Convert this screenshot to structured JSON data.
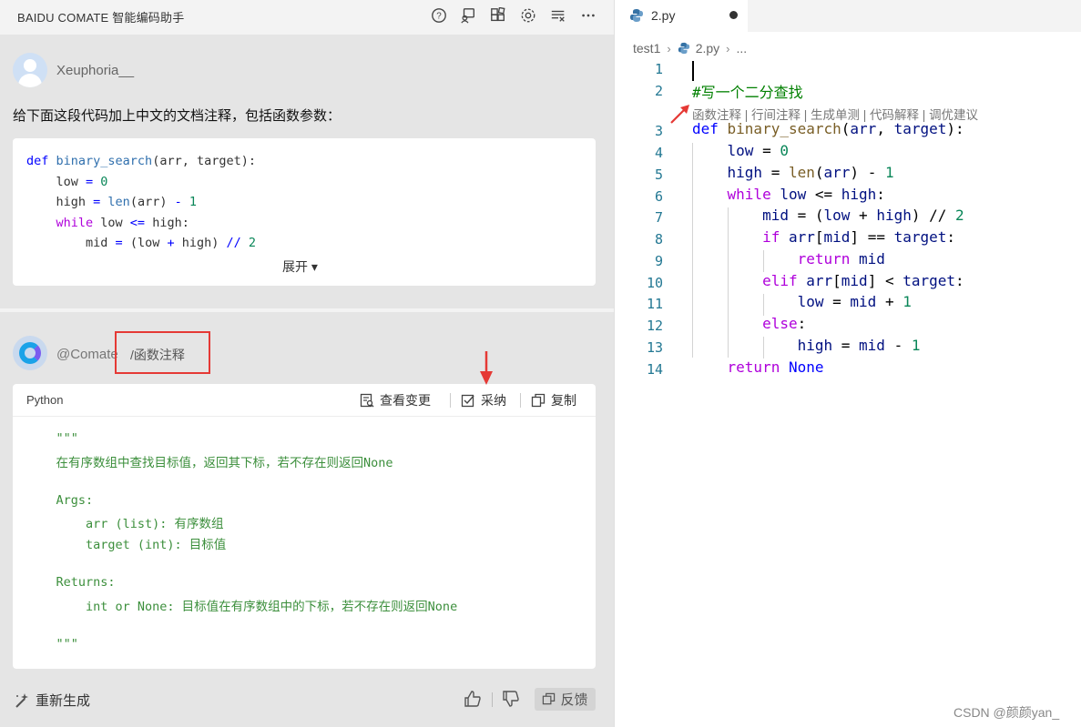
{
  "sidebar": {
    "title": "BAIDU COMATE 智能编码助手",
    "icons": [
      "help-icon",
      "chat-icon",
      "plugin-icon",
      "settings-icon",
      "clear-icon",
      "more-icon"
    ]
  },
  "user_message": {
    "name": "Xeuphoria__",
    "prompt": "给下面这段代码加上中文的文档注释，包括函数参数：",
    "code_lines": [
      {
        "parts": [
          {
            "t": "def ",
            "c": "kw"
          },
          {
            "t": "binary_search",
            "c": "fn"
          },
          {
            "t": "(arr, target):",
            "c": "op"
          }
        ]
      },
      {
        "parts": [
          {
            "t": "    low ",
            "c": "op"
          },
          {
            "t": "= ",
            "c": "kw"
          },
          {
            "t": "0",
            "c": "num"
          }
        ]
      },
      {
        "parts": [
          {
            "t": "    high ",
            "c": "op"
          },
          {
            "t": "= ",
            "c": "kw"
          },
          {
            "t": "len",
            "c": "fn"
          },
          {
            "t": "(arr) ",
            "c": "op"
          },
          {
            "t": "- ",
            "c": "kw"
          },
          {
            "t": "1",
            "c": "num"
          }
        ]
      },
      {
        "parts": [
          {
            "t": "    while ",
            "c": "kw2"
          },
          {
            "t": "low ",
            "c": "op"
          },
          {
            "t": "<= ",
            "c": "kw"
          },
          {
            "t": "high:",
            "c": "op"
          }
        ]
      },
      {
        "parts": [
          {
            "t": "        mid ",
            "c": "op"
          },
          {
            "t": "= ",
            "c": "kw"
          },
          {
            "t": "(low ",
            "c": "op"
          },
          {
            "t": "+ ",
            "c": "kw"
          },
          {
            "t": "high) ",
            "c": "op"
          },
          {
            "t": "// ",
            "c": "kw"
          },
          {
            "t": "2",
            "c": "num"
          }
        ]
      }
    ],
    "expand_label": "展开 ▾"
  },
  "bot_message": {
    "name": "@Comate",
    "command": "/函数注释",
    "result": {
      "language": "Python",
      "actions": {
        "view_changes": "查看变更",
        "accept": "采纳",
        "copy": "复制"
      },
      "doc_lines": [
        "    \"\"\"",
        "    在有序数组中查找目标值，返回其下标，若不存在则返回None",
        "",
        "    Args:",
        "        arr (list): 有序数组",
        "        target (int): 目标值",
        "",
        "    Returns:",
        "        int or None: 目标值在有序数组中的下标，若不存在则返回None",
        "",
        "    \"\"\""
      ]
    },
    "regenerate_label": "重新生成",
    "feedback_label": "反馈"
  },
  "editor": {
    "tab_label": "2.py",
    "breadcrumb": [
      "test1",
      "2.py",
      "..."
    ],
    "codelens": [
      "函数注释",
      "行间注释",
      "生成单测",
      "代码解释",
      "调优建议"
    ],
    "lines": [
      {
        "n": "1",
        "parts": []
      },
      {
        "n": "2",
        "parts": [
          {
            "t": "#写一个二分查找",
            "c": "cmt"
          }
        ]
      },
      {
        "n": "3",
        "parts": [
          {
            "t": "def ",
            "c": "kw"
          },
          {
            "t": "binary_search",
            "c": "fn"
          },
          {
            "t": "(",
            "c": "op"
          },
          {
            "t": "arr",
            "c": "var"
          },
          {
            "t": ", ",
            "c": "op"
          },
          {
            "t": "target",
            "c": "var"
          },
          {
            "t": "):",
            "c": "op"
          }
        ]
      },
      {
        "n": "4",
        "parts": [
          {
            "t": "    ",
            "c": "op"
          },
          {
            "t": "low",
            "c": "var"
          },
          {
            "t": " = ",
            "c": "op"
          },
          {
            "t": "0",
            "c": "num"
          }
        ]
      },
      {
        "n": "5",
        "parts": [
          {
            "t": "    ",
            "c": "op"
          },
          {
            "t": "high",
            "c": "var"
          },
          {
            "t": " = ",
            "c": "op"
          },
          {
            "t": "len",
            "c": "fn"
          },
          {
            "t": "(",
            "c": "op"
          },
          {
            "t": "arr",
            "c": "var"
          },
          {
            "t": ") - ",
            "c": "op"
          },
          {
            "t": "1",
            "c": "num"
          }
        ]
      },
      {
        "n": "6",
        "parts": [
          {
            "t": "    ",
            "c": "op"
          },
          {
            "t": "while ",
            "c": "kw2"
          },
          {
            "t": "low",
            "c": "var"
          },
          {
            "t": " <= ",
            "c": "op"
          },
          {
            "t": "high",
            "c": "var"
          },
          {
            "t": ":",
            "c": "op"
          }
        ]
      },
      {
        "n": "7",
        "parts": [
          {
            "t": "        ",
            "c": "op"
          },
          {
            "t": "mid",
            "c": "var"
          },
          {
            "t": " = (",
            "c": "op"
          },
          {
            "t": "low",
            "c": "var"
          },
          {
            "t": " + ",
            "c": "op"
          },
          {
            "t": "high",
            "c": "var"
          },
          {
            "t": ") // ",
            "c": "op"
          },
          {
            "t": "2",
            "c": "num"
          }
        ]
      },
      {
        "n": "8",
        "parts": [
          {
            "t": "        ",
            "c": "op"
          },
          {
            "t": "if ",
            "c": "kw2"
          },
          {
            "t": "arr",
            "c": "var"
          },
          {
            "t": "[",
            "c": "op"
          },
          {
            "t": "mid",
            "c": "var"
          },
          {
            "t": "] == ",
            "c": "op"
          },
          {
            "t": "target",
            "c": "var"
          },
          {
            "t": ":",
            "c": "op"
          }
        ]
      },
      {
        "n": "9",
        "parts": [
          {
            "t": "            ",
            "c": "op"
          },
          {
            "t": "return ",
            "c": "kw2"
          },
          {
            "t": "mid",
            "c": "var"
          }
        ]
      },
      {
        "n": "10",
        "parts": [
          {
            "t": "        ",
            "c": "op"
          },
          {
            "t": "elif ",
            "c": "kw2"
          },
          {
            "t": "arr",
            "c": "var"
          },
          {
            "t": "[",
            "c": "op"
          },
          {
            "t": "mid",
            "c": "var"
          },
          {
            "t": "] < ",
            "c": "op"
          },
          {
            "t": "target",
            "c": "var"
          },
          {
            "t": ":",
            "c": "op"
          }
        ]
      },
      {
        "n": "11",
        "parts": [
          {
            "t": "            ",
            "c": "op"
          },
          {
            "t": "low",
            "c": "var"
          },
          {
            "t": " = ",
            "c": "op"
          },
          {
            "t": "mid",
            "c": "var"
          },
          {
            "t": " + ",
            "c": "op"
          },
          {
            "t": "1",
            "c": "num"
          }
        ]
      },
      {
        "n": "12",
        "parts": [
          {
            "t": "        ",
            "c": "op"
          },
          {
            "t": "else",
            "c": "kw2"
          },
          {
            "t": ":",
            "c": "op"
          }
        ]
      },
      {
        "n": "13",
        "parts": [
          {
            "t": "            ",
            "c": "op"
          },
          {
            "t": "high",
            "c": "var"
          },
          {
            "t": " = ",
            "c": "op"
          },
          {
            "t": "mid",
            "c": "var"
          },
          {
            "t": " - ",
            "c": "op"
          },
          {
            "t": "1",
            "c": "num"
          }
        ]
      },
      {
        "n": "14",
        "parts": [
          {
            "t": "    ",
            "c": "op"
          },
          {
            "t": "return ",
            "c": "kw2"
          },
          {
            "t": "None",
            "c": "kw"
          }
        ]
      }
    ]
  },
  "watermark": "CSDN @颜颜yan_",
  "colors": {
    "highlight_red": "#e53935",
    "doc_green": "#3c8f3c",
    "line_number": "#237893"
  }
}
